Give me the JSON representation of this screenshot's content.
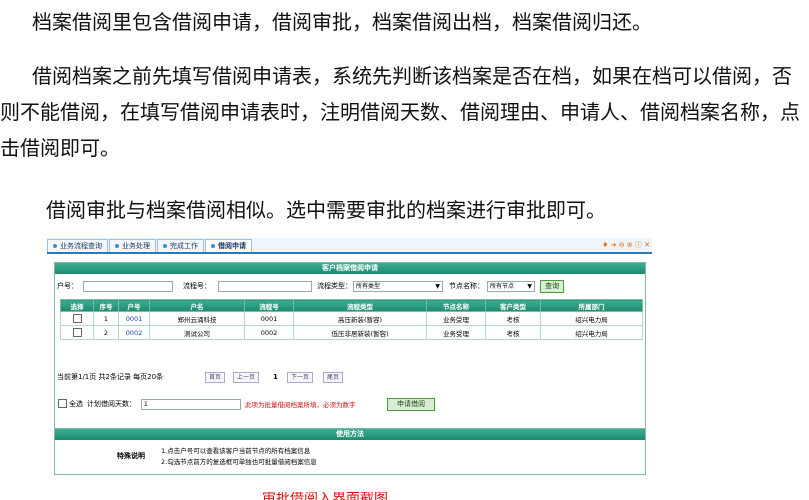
{
  "paragraphs": {
    "p1": "档案借阅里包含借阅申请，借阅审批，档案借阅出档，档案借阅归还。",
    "p2": "借阅档案之前先填写借阅申请表，系统先判断该档案是否在档，如果在档可以借阅，否则不能借阅，在填写借阅申请表时，注明借阅天数、借阅理由、申请人、借阅档案名称，点击借阅即可。",
    "p3": "借阅审批与档案借阅相似。选中需要审批的档案进行审批即可。"
  },
  "tabs": [
    "业务流程查询",
    "业务处理",
    "完成工作",
    "借阅申请"
  ],
  "tab_tools": "♦ ➔ ⊖ ⊕ ⓘ ✕",
  "form": {
    "title": "客户档案借阅申请",
    "account_label": "户号：",
    "flow_no_label": "流程号：",
    "flow_type_label": "流程类型：",
    "flow_type_value": "所有类型",
    "node_label": "节点名称：",
    "node_value": "所有节点",
    "query_btn": "查询"
  },
  "table": {
    "headers": [
      "选择",
      "序号",
      "户号",
      "户名",
      "流程号",
      "流程类型",
      "节点名称",
      "客户类型",
      "所属部门"
    ],
    "rows": [
      [
        "",
        "1",
        "0001",
        "郑州云涌科技",
        "0001",
        "高压新装(暂容)",
        "业务受理",
        "考核",
        "绍兴电力局"
      ],
      [
        "",
        "2",
        "0002",
        "测试公司",
        "0002",
        "低压非居新装(暂容)",
        "业务受理",
        "考核",
        "绍兴电力局"
      ]
    ]
  },
  "pager": {
    "info": "当前第1/1页 共2条记录 每页20条",
    "first": "首页",
    "prev": "上一页",
    "current": "1",
    "next": "下一页",
    "last": "尾页"
  },
  "bottom": {
    "select_all": "全选",
    "days_label": "计划借阅天数：",
    "days_value": "1",
    "warning": "此项为批量借阅档案所填，必须为数字",
    "apply_btn": "申请借阅"
  },
  "usage": {
    "title": "使用方法",
    "label": "特殊说明",
    "lines": [
      "1.点击户号可以查看该客户当前节点的所有档案信息",
      "2.勾选节点前方的复选框可单独也可批量借阅档案信息"
    ]
  },
  "tail_caption": "审批借阅入界面截图"
}
